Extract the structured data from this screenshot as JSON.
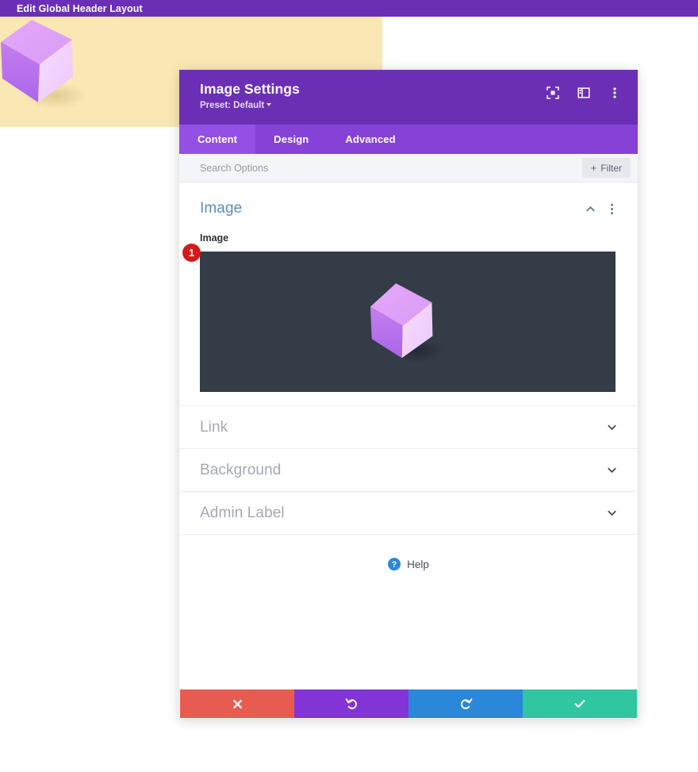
{
  "admin_bar": {
    "title": "Edit Global Header Layout"
  },
  "page": {
    "hero_background_color": "#fae8b4",
    "hero_image_alt": "purple-cube"
  },
  "modal": {
    "title": "Image Settings",
    "preset_label": "Preset: Default",
    "header_icons": [
      {
        "name": "focus-mode-icon",
        "label": "Focus Mode"
      },
      {
        "name": "layout-view-icon",
        "label": "Layout View"
      },
      {
        "name": "more-options-icon",
        "label": "More Options"
      }
    ],
    "tabs": [
      {
        "label": "Content",
        "active": true
      },
      {
        "label": "Design",
        "active": false
      },
      {
        "label": "Advanced",
        "active": false
      }
    ],
    "search": {
      "value": "",
      "placeholder": "Search Options"
    },
    "filter_button": {
      "label": "Filter",
      "plus": "+"
    },
    "sections": {
      "image": {
        "title": "Image",
        "field_label": "Image",
        "badge": "1",
        "badge_color": "#d21c1c",
        "preview_background": "#343c47",
        "expanded": true
      },
      "collapsed": [
        {
          "title": "Link"
        },
        {
          "title": "Background"
        },
        {
          "title": "Admin Label"
        }
      ]
    },
    "help": {
      "label": "Help",
      "icon_color": "#2b87da"
    },
    "footer_actions": [
      {
        "name": "close",
        "glyph": "✕",
        "color": "#e85b51"
      },
      {
        "name": "undo",
        "glyph": "↺",
        "color": "#8234d6"
      },
      {
        "name": "redo",
        "glyph": "↻",
        "color": "#2b87da"
      },
      {
        "name": "save",
        "glyph": "✓",
        "color": "#2fc6a0"
      }
    ]
  },
  "colors": {
    "brand_purple": "#6b2fb5",
    "tab_bar_purple": "#8642d6",
    "tab_active_purple": "#9450e4",
    "section_title_blue": "#5a8dbb"
  }
}
